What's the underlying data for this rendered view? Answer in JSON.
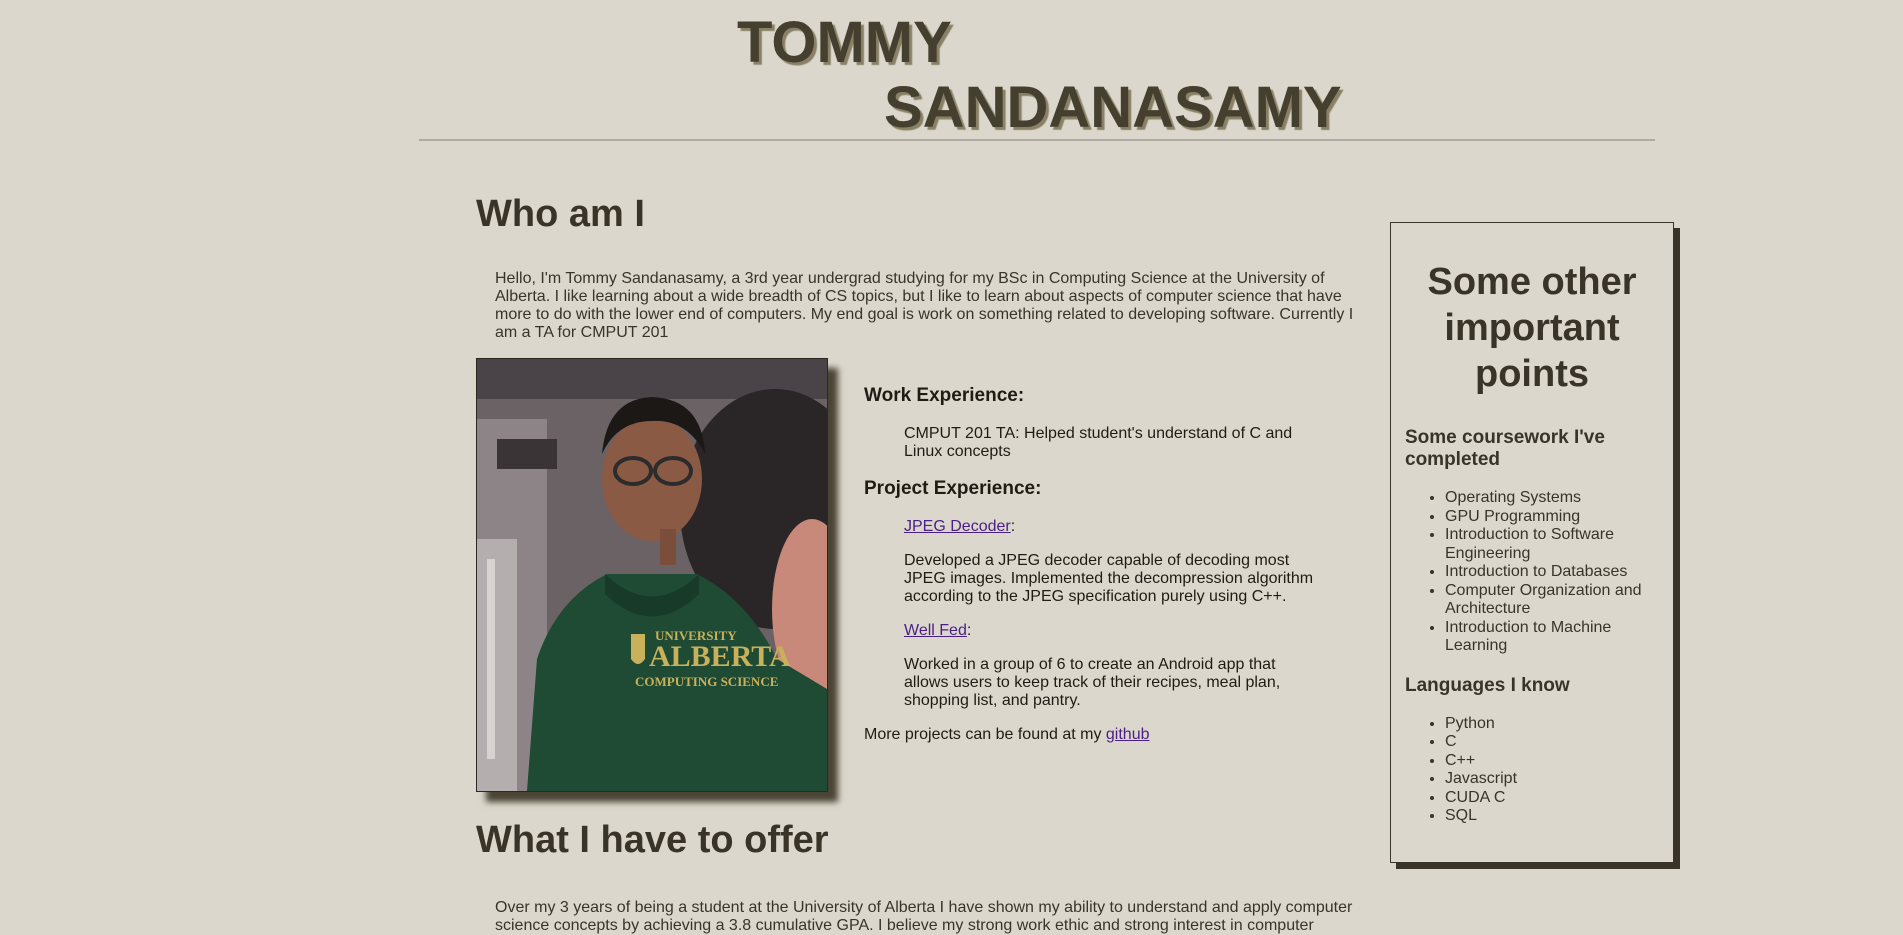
{
  "header": {
    "name_first": "TOMMY",
    "name_last": "SANDANASAMY"
  },
  "about": {
    "heading": "Who am I",
    "text": "Hello, I'm Tommy Sandanasamy, a 3rd year undergrad studying for my BSc in Computing Science at the University of Alberta. I like learning about a wide breadth of CS topics, but I like to learn about aspects of computer science that have more to do with the lower end of computers. My end goal is work on something related to developing software. Currently I am a TA for CMPUT 201",
    "photo_text": [
      "UNIVERSITY",
      "ALBERTA",
      "COMPUTING SCIENCE"
    ]
  },
  "experience": {
    "work_heading": "Work Experience:",
    "work_text": "CMPUT 201 TA: Helped student's understand of C and Linux concepts",
    "project_heading": "Project Experience:",
    "projects": [
      {
        "link": "JPEG Decoder",
        "colon": ":",
        "description": "Developed a JPEG decoder capable of decoding most JPEG images. Implemented the decompression algorithm according to the JPEG specification purely using C++."
      },
      {
        "link": "Well Fed",
        "colon": ":",
        "description": "Worked in a group of 6 to create an Android app that allows users to keep track of their recipes, meal plan, shopping list, and pantry."
      }
    ],
    "more_text": "More projects can be found at my ",
    "more_link": "github"
  },
  "offer": {
    "heading": "What I have to offer",
    "text": "Over my 3 years of being a student at the University of Alberta I have shown my ability to understand and apply computer science concepts by achieving a 3.8 cumulative GPA. I believe my strong work ethic and strong interest in computer"
  },
  "sidebar": {
    "heading": "Some other important points",
    "coursework_heading": "Some coursework I've completed",
    "courses": [
      "Operating Systems",
      "GPU Programming",
      "Introduction to Software Engineering",
      "Introduction to Databases",
      "Computer Organization and Architecture",
      "Introduction to Machine Learning"
    ],
    "languages_heading": "Languages I know",
    "languages": [
      "Python",
      "C",
      "C++",
      "Javascript",
      "CUDA C",
      "SQL"
    ]
  },
  "colors": {
    "background": "#dbd7cc",
    "text": "#3a3428",
    "link": "#4a1f86",
    "hoodie": "#1f4a34"
  }
}
